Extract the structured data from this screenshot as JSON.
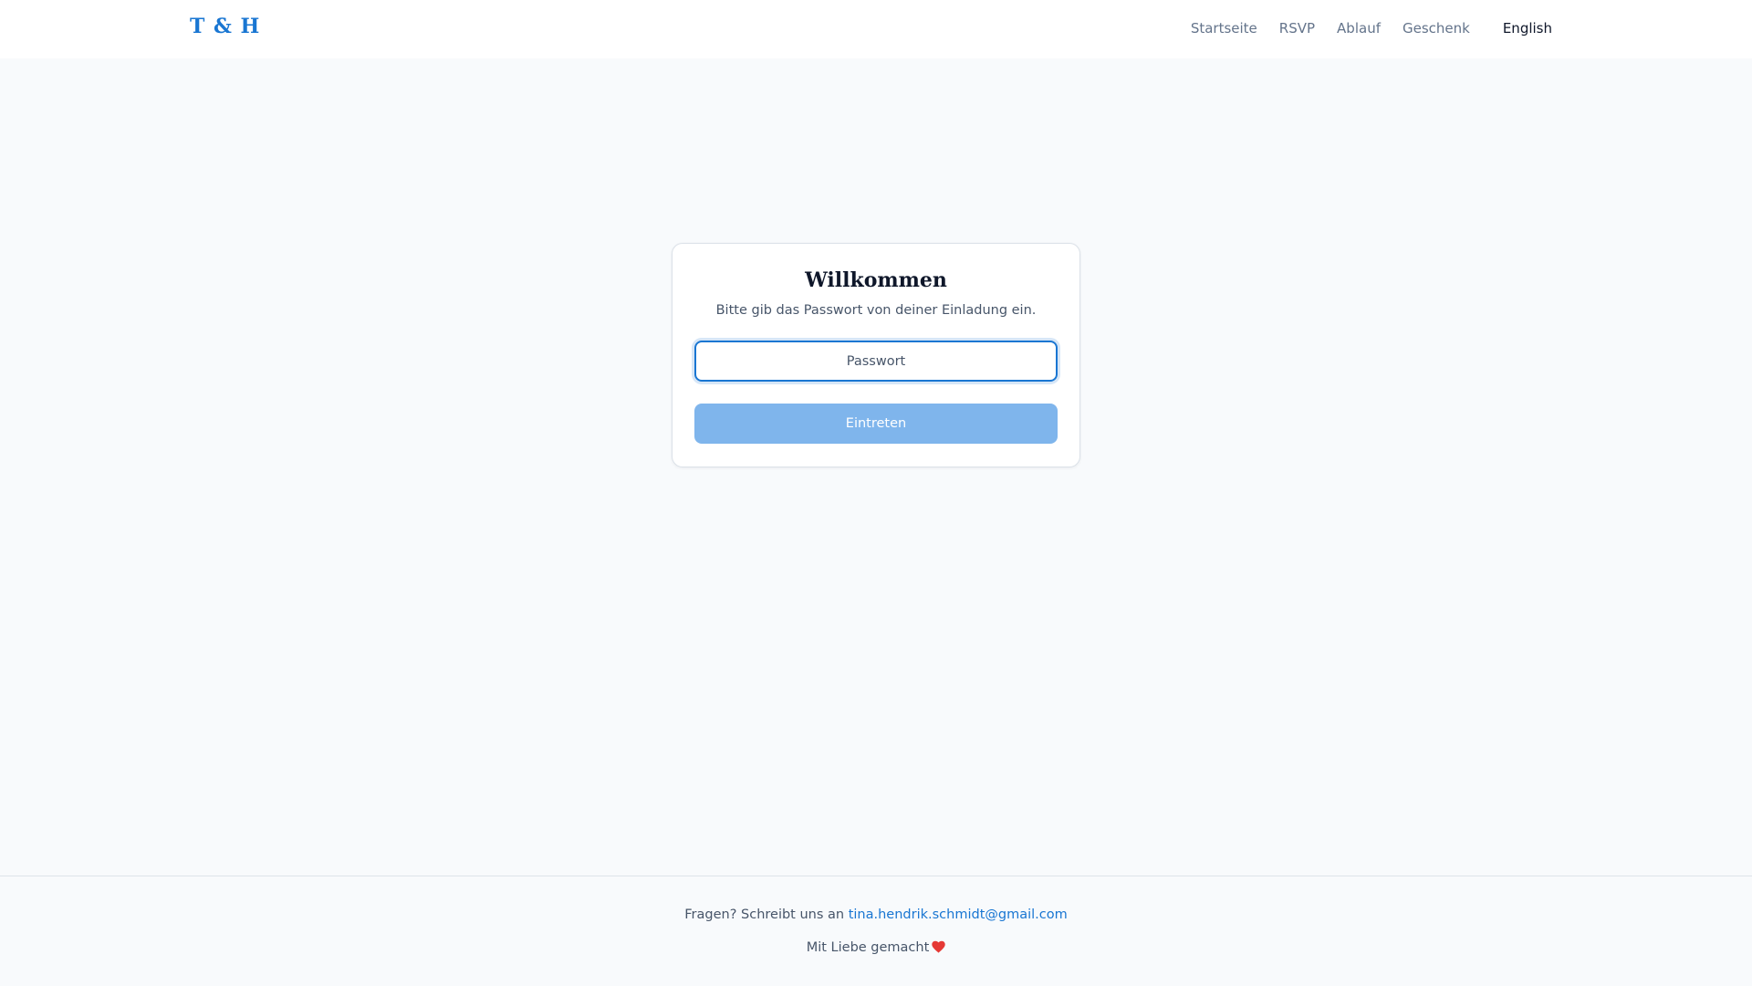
{
  "header": {
    "brand": "T & H",
    "nav": [
      "Startseite",
      "RSVP",
      "Ablauf",
      "Geschenk"
    ],
    "language": "English"
  },
  "login": {
    "title": "Willkommen",
    "subtitle": "Bitte gib das Passwort von deiner Einladung ein.",
    "password_placeholder": "Passwort",
    "submit_label": "Eintreten"
  },
  "footer": {
    "contact_text": "Fragen? Schreibt uns an",
    "email": "tina.hendrik.schmidt@gmail.com",
    "made_with": "Mit Liebe gemacht",
    "heart_icon": "heart-icon"
  },
  "colors": {
    "accent": "#1976d2",
    "button_disabled": "#7fb5ec",
    "heart": "#e53935",
    "page_bg": "#f8fafc"
  }
}
